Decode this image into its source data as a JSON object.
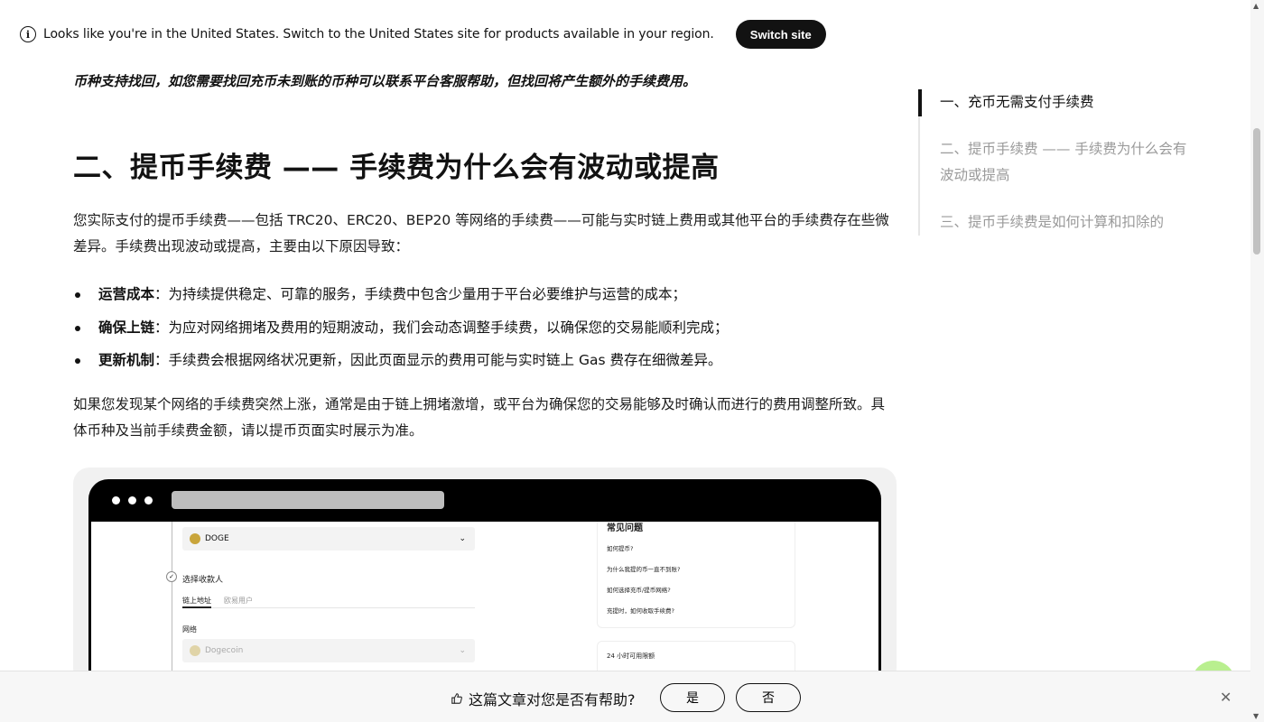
{
  "banner": {
    "message": "Looks like you're in the United States. Switch to the United States site for products available in your region.",
    "switch_label": "Switch site"
  },
  "article": {
    "lead": "币种支持找回，如您需要找回充币未到账的币种可以联系平台客服帮助，但找回将产生额外的手续费用。",
    "heading": "二、提币手续费 —— 手续费为什么会有波动或提高",
    "intro": "您实际支付的提币手续费——包括 TRC20、ERC20、BEP20 等网络的手续费——可能与实时链上费用或其他平台的手续费存在些微差异。手续费出现波动或提高，主要由以下原因导致：",
    "bullets": [
      {
        "title": "运营成本",
        "text": "：为持续提供稳定、可靠的服务，手续费中包含少量用于平台必要维护与运营的成本；"
      },
      {
        "title": "确保上链",
        "text": "：为应对网络拥堵及费用的短期波动，我们会动态调整手续费，以确保您的交易能顺利完成；"
      },
      {
        "title": "更新机制",
        "text": "：手续费会根据网络状况更新，因此页面显示的费用可能与实时链上 Gas 费存在细微差异。"
      }
    ],
    "outro": "如果您发现某个网络的手续费突然上涨，通常是由于链上拥堵激增，或平台为确保您的交易能够及时确认而进行的费用调整所致。具体币种及当前手续费金额，请以提币页面实时展示为准。"
  },
  "screenshot": {
    "coin_select": "DOGE",
    "recipient_label": "选择收款人",
    "tab_onchain": "链上地址",
    "tab_user": "欧易用户",
    "network_label": "网络",
    "network_value": "Dogecoin",
    "faq_title": "常见问题",
    "faq_items": [
      "如何提币?",
      "为什么我提的币一直不到账?",
      "如何选择充币/提币网络?",
      "充提时，如何收取手续费?"
    ],
    "limit_label": "24 小时可用限额"
  },
  "toc": {
    "items": [
      "一、充币无需支付手续费",
      "二、提币手续费 —— 手续费为什么会有波动或提高",
      "三、提币手续费是如何计算和扣除的"
    ]
  },
  "feedback": {
    "question": "这篇文章对您是否有帮助?",
    "yes": "是",
    "no": "否",
    "close": "✕"
  },
  "icons": {
    "info": "info-icon",
    "thumb": "thumbs-up-icon",
    "close": "close-icon",
    "chevron": "chevron-down-icon"
  },
  "colors": {
    "primary": "#121212",
    "muted": "#9a9a9a",
    "fab": "#b9ef8f"
  }
}
